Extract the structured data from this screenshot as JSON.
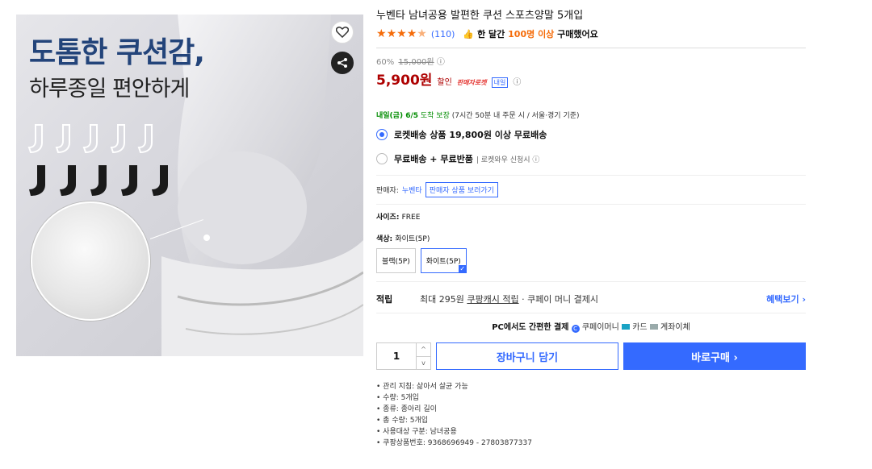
{
  "image": {
    "headline": "도톰한 쿠션감,",
    "subline": "하루종일 편안하게"
  },
  "product": {
    "title": "누벤타 남녀공용 발편한 쿠션 스포츠양말 5개입",
    "stars": 4.5,
    "review_count": "(110)",
    "monthly_buyers_pre": "한 달간",
    "monthly_buyers_hl": "100명 이상",
    "monthly_buyers_post": "구매했어요"
  },
  "price": {
    "discount": "60%",
    "original": "15,000원",
    "final": "5,900원",
    "tag": "할인",
    "badge": "판매자로켓",
    "badge_box": "내일"
  },
  "delivery": {
    "arrival": "내일(금) 6/5",
    "guarantee": "도착 보장",
    "condition": "(7시간 50분 내 주문 시 / 서울·경기 기준)",
    "option1": "로켓배송 상품 19,800원 이상 무료배송",
    "option2": "무료배송 + 무료반품",
    "option2_sub": "| 로켓와우 신청시 ⓘ"
  },
  "seller": {
    "label": "판매자:",
    "name": "누벤타",
    "button": "판매자 상품 보러가기"
  },
  "options": {
    "size_label": "사이즈:",
    "size_value": "FREE",
    "color_label": "색상:",
    "color_value": "화이트(5P)",
    "color_choices": [
      "블랙(5P)",
      "화이트(5P)"
    ]
  },
  "reward": {
    "label": "적립",
    "text_pre": "최대 295원",
    "link": "쿠팡캐시 적립",
    "text_post": "· 쿠페이 머니 결제시",
    "more": "혜택보기 ›"
  },
  "payment": {
    "lead": "PC에서도 간편한 결제",
    "coupay": "쿠페이머니",
    "card": "카드",
    "bank": "계좌이체"
  },
  "cart": {
    "quantity": "1",
    "add_to_cart": "장바구니 담기",
    "buy_now": "바로구매 ›"
  },
  "details": [
    "관리 지침: 삶아서 살균 가능",
    "수량: 5개입",
    "종류: 종아리 길이",
    "총 수량: 5개입",
    "사용대상 구분: 남녀공용",
    "쿠팡상품번호: 9368696949 - 27803877337"
  ],
  "colors": {
    "accent": "#346aff",
    "price": "#ae0000",
    "orange": "#f56c0a",
    "headline": "#23447a"
  }
}
